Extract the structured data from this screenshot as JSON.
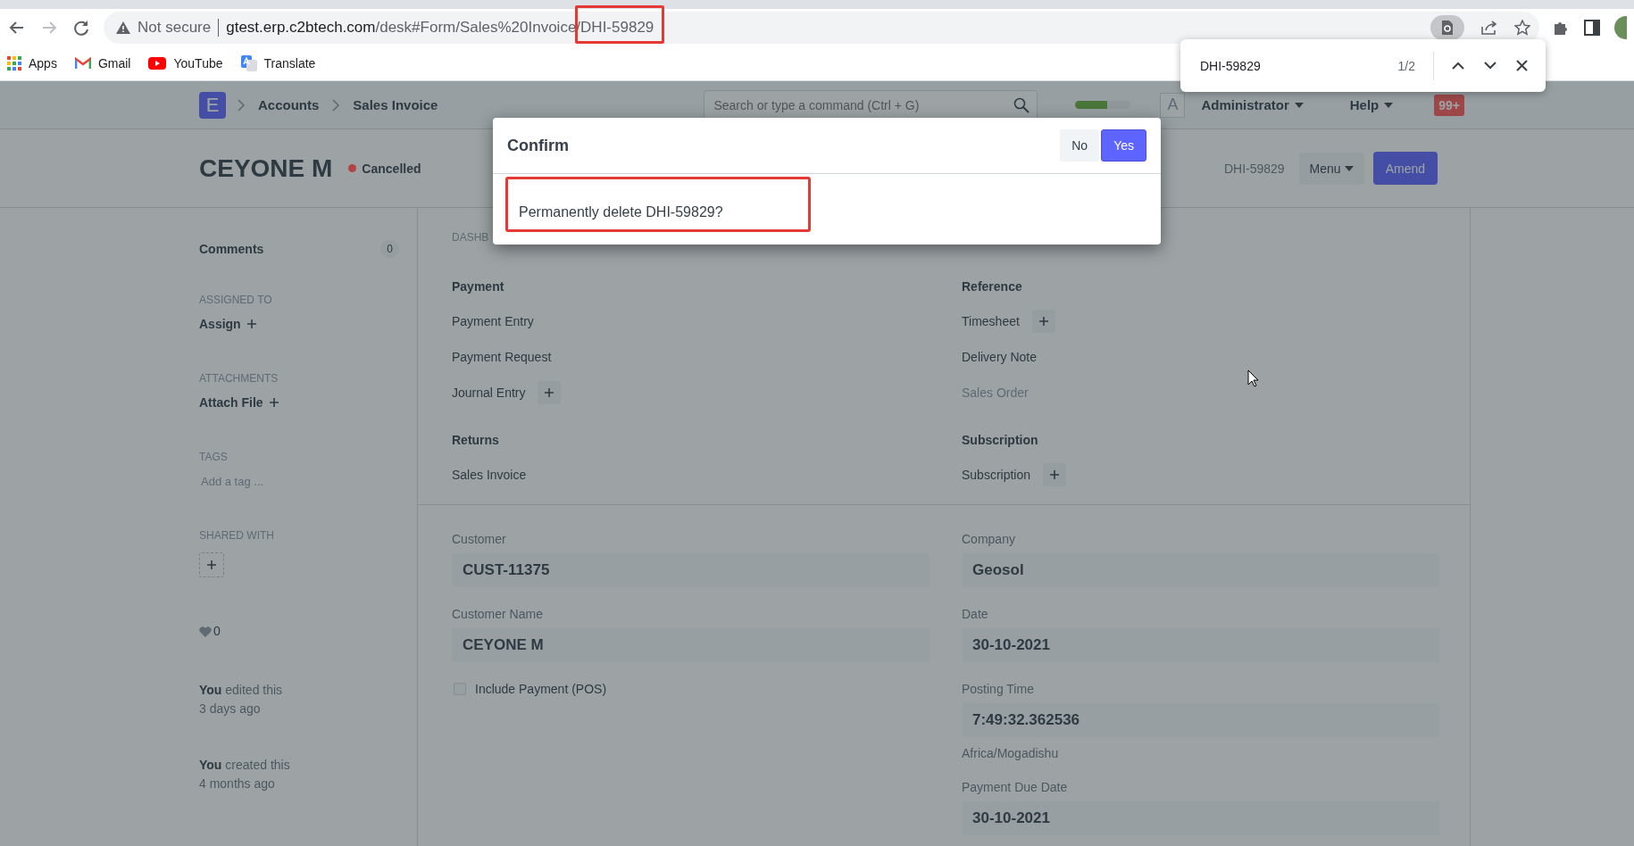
{
  "browser": {
    "insecure_label": "Not secure",
    "url_host": "gtest.erp.c2btech.com",
    "url_parts": [
      {
        "text": "/desk#Form/Sales%20Invoice",
        "highlighted": false
      },
      {
        "text": "/DHI-59829",
        "highlighted": true
      }
    ],
    "bookmarks": [
      {
        "label": "Apps",
        "kind": "apps"
      },
      {
        "label": "Gmail",
        "kind": "gmail"
      },
      {
        "label": "YouTube",
        "kind": "youtube"
      },
      {
        "label": "Translate",
        "kind": "translate"
      }
    ]
  },
  "find_bar": {
    "query": "DHI-59829",
    "count": "1/2"
  },
  "navbar": {
    "logo": "E",
    "breadcrumbs": [
      "Accounts",
      "Sales Invoice"
    ],
    "search_placeholder": "Search or type a command (Ctrl + G)",
    "progress": {
      "level": 0.57
    },
    "avatar": "A",
    "user": "Administrator",
    "help": "Help",
    "notifications": "99+"
  },
  "header": {
    "title": "CEYONE M",
    "status": {
      "label": "Cancelled",
      "color": "#b04545"
    },
    "doc_name": "DHI-59829",
    "menu": "Menu",
    "primary_button": "Amend"
  },
  "sidebar": {
    "comments": {
      "label": "Comments",
      "count": "0"
    },
    "sections": [
      {
        "heading": "ASSIGNED TO",
        "action": "Assign",
        "kind": "add"
      },
      {
        "heading": "ATTACHMENTS",
        "action": "Attach File",
        "kind": "add"
      },
      {
        "heading": "TAGS",
        "action": "Add a tag ...",
        "kind": "tag"
      },
      {
        "heading": "SHARED WITH",
        "kind": "share"
      }
    ],
    "likes": "0",
    "activity": [
      {
        "text": "**You** edited this",
        "time": "3 days ago"
      },
      {
        "text": "**You** created this",
        "time": "4 months ago"
      }
    ]
  },
  "dashboard": {
    "label": "DASHB",
    "sections": [
      {
        "title": "Payment",
        "items": [
          {
            "label": "Payment Entry",
            "addable": false,
            "disabled": false
          },
          {
            "label": "Payment Request",
            "addable": false,
            "disabled": false
          },
          {
            "label": "Journal Entry",
            "addable": true,
            "disabled": false
          }
        ]
      },
      {
        "title": "Reference",
        "items": [
          {
            "label": "Timesheet",
            "addable": true,
            "disabled": false
          },
          {
            "label": "Delivery Note",
            "addable": false,
            "disabled": false
          },
          {
            "label": "Sales Order",
            "addable": false,
            "disabled": true
          }
        ]
      },
      {
        "title": "Returns",
        "items": [
          {
            "label": "Sales Invoice",
            "addable": false,
            "disabled": false
          }
        ]
      },
      {
        "title": "Subscription",
        "items": [
          {
            "label": "Subscription",
            "addable": true,
            "disabled": false
          }
        ]
      }
    ]
  },
  "form": {
    "left": [
      {
        "kind": "field",
        "label": "Customer",
        "value": "CUST-11375"
      },
      {
        "kind": "field",
        "label": "Customer Name",
        "value": "CEYONE M"
      },
      {
        "kind": "check",
        "label": "Include Payment (POS)",
        "checked": false
      }
    ],
    "right": [
      {
        "kind": "field",
        "label": "Company",
        "value": "Geosol"
      },
      {
        "kind": "field",
        "label": "Date",
        "value": "30-10-2021"
      },
      {
        "kind": "field",
        "label": "Posting Time",
        "value": "7:49:32.362536"
      },
      {
        "kind": "note",
        "label": "Africa/Mogadishu"
      },
      {
        "kind": "field",
        "label": "Payment Due Date",
        "value": "30-10-2021"
      }
    ]
  },
  "dialog": {
    "title": "Confirm",
    "buttons": [
      {
        "label": "No",
        "kind": "default"
      },
      {
        "label": "Yes",
        "kind": "primary"
      }
    ],
    "message": "Permanently delete DHI-59829?",
    "highlighted": true
  }
}
